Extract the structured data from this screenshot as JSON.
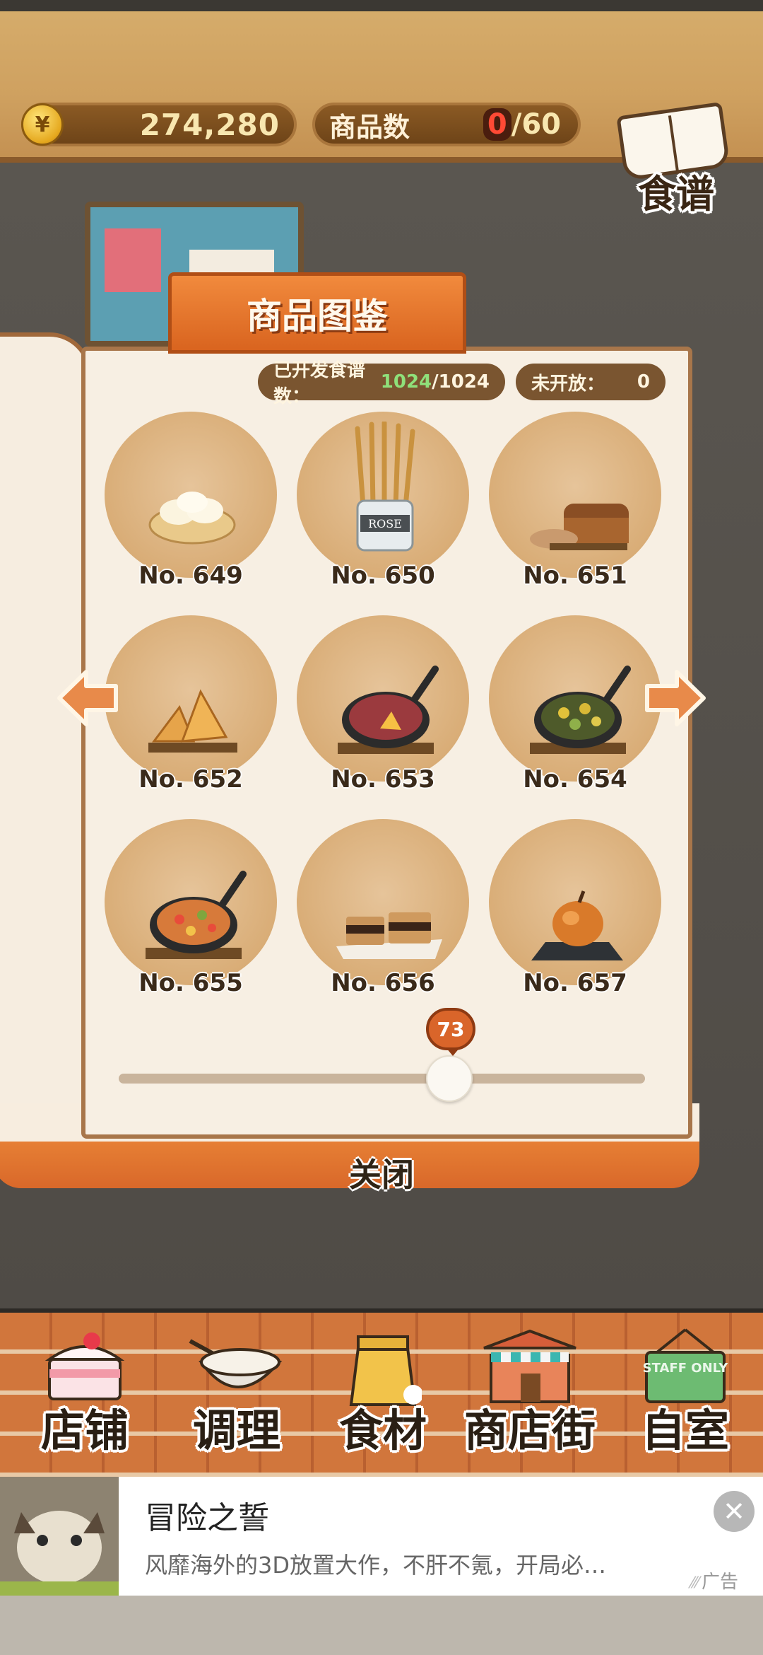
{
  "header": {
    "currency_symbol": "¥",
    "money": "274,280",
    "goods_label": "商品数",
    "goods_count": "0",
    "goods_max": "/60",
    "recipe_label": "食谱"
  },
  "catalog": {
    "title": "商品图鉴",
    "developed_label": "已开发食谱数：",
    "developed_count": "1024",
    "developed_total": "/1024",
    "unopened_label": "未开放：",
    "unopened_count": "0",
    "items": [
      {
        "label": "No. 649",
        "icon": "steamed-buns-icon"
      },
      {
        "label": "No. 650",
        "icon": "breadsticks-jar-icon"
      },
      {
        "label": "No. 651",
        "icon": "bread-loaf-icon"
      },
      {
        "label": "No. 652",
        "icon": "pastry-icon"
      },
      {
        "label": "No. 653",
        "icon": "skillet-meat-icon"
      },
      {
        "label": "No. 654",
        "icon": "skillet-vegetables-icon"
      },
      {
        "label": "No. 655",
        "icon": "skillet-paella-icon"
      },
      {
        "label": "No. 656",
        "icon": "smores-icon"
      },
      {
        "label": "No. 657",
        "icon": "baked-apple-icon"
      }
    ],
    "page_indicator": "73",
    "page_fraction": 0.63,
    "close_label": "关闭"
  },
  "nav": {
    "items": [
      {
        "label": "店铺",
        "icon": "cake-icon"
      },
      {
        "label": "调理",
        "icon": "mixing-bowl-icon"
      },
      {
        "label": "食材",
        "icon": "flour-sack-icon"
      },
      {
        "label": "商店街",
        "icon": "shop-building-icon"
      },
      {
        "label": "自室",
        "icon": "staff-only-sign-icon"
      }
    ],
    "staff_sign": "STAFF ONLY"
  },
  "ad": {
    "title": "冒险之誓",
    "description": "风靡海外的3D放置大作，不肝不氪，开局必…",
    "tag": "广告",
    "close_symbol": "✕"
  }
}
